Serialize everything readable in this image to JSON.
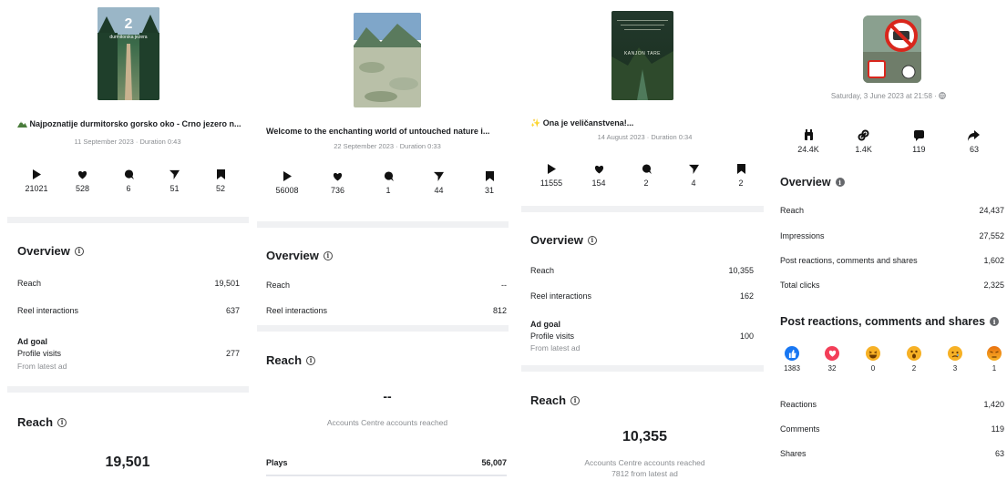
{
  "panels": [
    {
      "title": "Najpoznatije durmitorsko gorsko oko - Crno jezero n...",
      "meta": "11 September 2023 · Duration 0:43",
      "thumb_number": "2",
      "thumb_caption": "durmitorska jezera",
      "stats": {
        "plays": "21021",
        "likes": "528",
        "comments": "6",
        "shares": "51",
        "saves": "52"
      },
      "overview_title": "Overview",
      "reach_label": "Reach",
      "reach_value": "19,501",
      "interactions_label": "Reel interactions",
      "interactions_value": "637",
      "ad_goal_label": "Ad goal",
      "profile_visits_label": "Profile visits",
      "profile_visits_value": "277",
      "from_latest_ad": "From latest ad",
      "reach_section_title": "Reach",
      "reach_big": "19,501"
    },
    {
      "title": "Welcome to the enchanting world of untouched nature i...",
      "meta": "22 September 2023 · Duration 0:33",
      "stats": {
        "plays": "56008",
        "likes": "736",
        "comments": "1",
        "shares": "44",
        "saves": "31"
      },
      "overview_title": "Overview",
      "reach_label": "Reach",
      "reach_value": "--",
      "interactions_label": "Reel interactions",
      "interactions_value": "812",
      "reach_section_title": "Reach",
      "reach_big": "--",
      "accounts_reached": "Accounts Centre accounts reached",
      "plays_label": "Plays",
      "plays_value": "56,007"
    },
    {
      "title": "✨ Ona je veličanstvena!...",
      "meta": "14 August 2023 · Duration 0:34",
      "thumb_text": "KANJON TARE",
      "stats": {
        "plays": "11555",
        "likes": "154",
        "comments": "2",
        "shares": "4",
        "saves": "2"
      },
      "overview_title": "Overview",
      "reach_label": "Reach",
      "reach_value": "10,355",
      "interactions_label": "Reel interactions",
      "interactions_value": "162",
      "ad_goal_label": "Ad goal",
      "profile_visits_label": "Profile visits",
      "profile_visits_value": "100",
      "from_latest_ad": "From latest ad",
      "reach_section_title": "Reach",
      "reach_big": "10,355",
      "accounts_reached": "Accounts Centre accounts reached",
      "from_latest_ad_count": "7812 from latest ad"
    },
    {
      "meta": "Saturday, 3 June 2023 at 21:58 ·",
      "stats": {
        "reactions": "24.4K",
        "link_clicks": "1.4K",
        "comments": "119",
        "shares": "63"
      },
      "overview_title": "Overview",
      "reach_label": "Reach",
      "reach_value": "24,437",
      "impressions_label": "Impressions",
      "impressions_value": "27,552",
      "prcs_label": "Post reactions, comments and shares",
      "prcs_value": "1,602",
      "clicks_label": "Total clicks",
      "clicks_value": "2,325",
      "reactions_section_title": "Post reactions, comments and shares",
      "reaction_counts": {
        "like": "1383",
        "love": "32",
        "haha": "0",
        "wow": "2",
        "sad": "3",
        "angry": "1"
      },
      "reactions_label": "Reactions",
      "reactions_value": "1,420",
      "comments_label": "Comments",
      "comments_value": "119",
      "shares_label": "Shares",
      "shares_value": "63"
    }
  ],
  "colors": {
    "like": "#1877f2",
    "love": "#f33e58",
    "emoji": "#f7b125",
    "angry": "#e9710f",
    "separator": "#f0f1f3",
    "muted": "#8a8d91"
  }
}
